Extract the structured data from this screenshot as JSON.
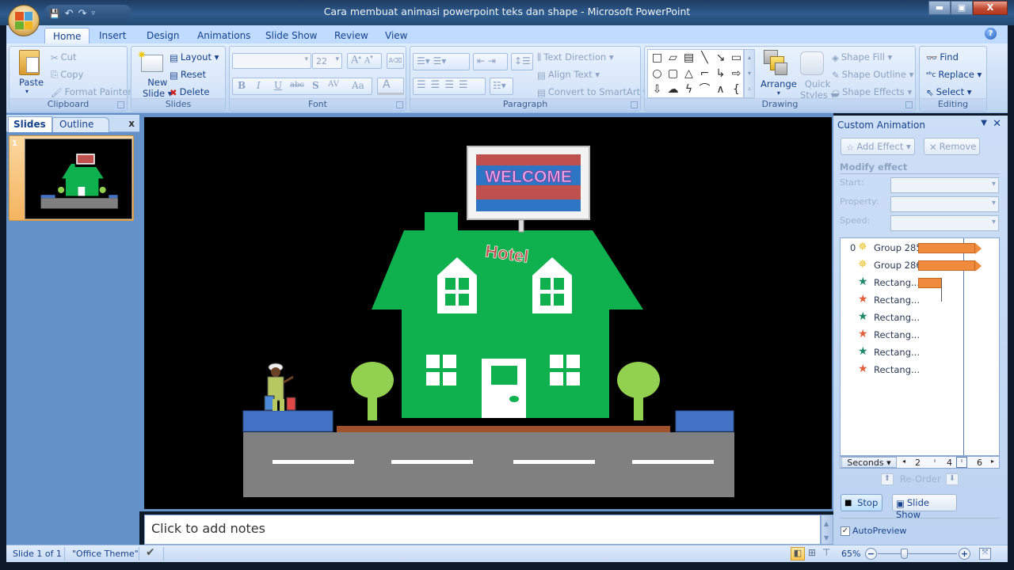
{
  "window": {
    "title": "Cara membuat animasi powerpoint teks dan shape - Microsoft PowerPoint",
    "controls": {
      "minimize": "▁",
      "maximize": "▢",
      "close": "X"
    }
  },
  "quick_access": {
    "save": "💾",
    "undo": "↶",
    "redo": "↷",
    "customize": "⩡"
  },
  "tabs": [
    "Home",
    "Insert",
    "Design",
    "Animations",
    "Slide Show",
    "Review",
    "View"
  ],
  "active_tab": "Home",
  "ribbon": {
    "clipboard": {
      "label": "Clipboard",
      "paste": "Paste",
      "cut": "Cut",
      "copy": "Copy",
      "format_painter": "Format Painter"
    },
    "slides": {
      "label": "Slides",
      "new_slide_1": "New",
      "new_slide_2": "Slide ▾",
      "layout": "Layout ▾",
      "reset": "Reset",
      "delete": "Delete"
    },
    "font": {
      "label": "Font",
      "font_name": "",
      "font_size": "22",
      "grow": "A",
      "shrink": "A",
      "bold": "B",
      "italic": "I",
      "underline": "U",
      "strike": "abc",
      "shadow": "S",
      "spacing": "AV",
      "case": "Aa",
      "color": "A"
    },
    "paragraph": {
      "label": "Paragraph",
      "text_direction": "Text Direction ▾",
      "align_text": "Align Text ▾",
      "convert_smartart": "Convert to SmartArt ▾"
    },
    "drawing": {
      "label": "Drawing",
      "arrange": "Arrange",
      "quick_styles_1": "Quick",
      "quick_styles_2": "Styles ▾",
      "shape_fill": "Shape Fill ▾",
      "shape_outline": "Shape Outline ▾",
      "shape_effects": "Shape Effects ▾",
      "shapes": [
        "□",
        "▱",
        "▤",
        "╲",
        "↘",
        "▭",
        "○",
        "▢",
        "△",
        "⌐",
        "↳",
        "⇨",
        "⇩",
        "☁",
        "ϟ",
        "⌒",
        "∧",
        "{"
      ]
    },
    "editing": {
      "label": "Editing",
      "find": "Find",
      "replace": "Replace ▾",
      "select": "Select ▾"
    }
  },
  "left_pane": {
    "tab_slides": "Slides",
    "tab_outline": "Outline",
    "close": "x",
    "slide_number": "1"
  },
  "slide": {
    "sign_text": "WELCOME",
    "hotel_text": "Hotel",
    "colors": {
      "house": "#0fb04e",
      "tree": "#92d050",
      "road": "#808080",
      "sidewalk": "#4472c4",
      "curb": "#a0522d",
      "sign_red": "#c0504d",
      "sign_blue": "#2e75c6",
      "sign_text": "#e8a0e8"
    }
  },
  "notes": {
    "placeholder": "Click to add notes"
  },
  "status": {
    "slide": "Slide 1 of 1",
    "theme": "\"Office Theme\"",
    "zoom": "65%",
    "zoom_out": "−",
    "zoom_in": "+"
  },
  "task_pane": {
    "title": "Custom Animation",
    "add_effect": "Add Effect ▾",
    "remove": "Remove",
    "modify_effect": "Modify effect",
    "start_label": "Start:",
    "property_label": "Property:",
    "speed_label": "Speed:",
    "items": [
      {
        "num": "0",
        "icon": "emphasis-star",
        "label": "Group 285",
        "bar_start": 0,
        "bar_end": 4
      },
      {
        "num": "",
        "icon": "emphasis-star",
        "label": "Group 286",
        "bar_start": 0,
        "bar_end": 4
      },
      {
        "num": "",
        "icon": "entrance-star",
        "label": "Rectang...",
        "bar_start": 0,
        "bar_end": 1.5
      },
      {
        "num": "",
        "icon": "exit-star",
        "label": "Rectang..."
      },
      {
        "num": "",
        "icon": "entrance-star",
        "label": "Rectang..."
      },
      {
        "num": "",
        "icon": "exit-star",
        "label": "Rectang..."
      },
      {
        "num": "",
        "icon": "entrance-star",
        "label": "Rectang..."
      },
      {
        "num": "",
        "icon": "exit-star",
        "label": "Rectang..."
      }
    ],
    "timeline": {
      "unit": "Seconds ▾",
      "ticks": [
        "2",
        "4",
        "6"
      ]
    },
    "reorder": "Re-Order",
    "stop": "Stop",
    "slide_show": "Slide Show",
    "autopreview": "AutoPreview",
    "autopreview_checked": true
  }
}
